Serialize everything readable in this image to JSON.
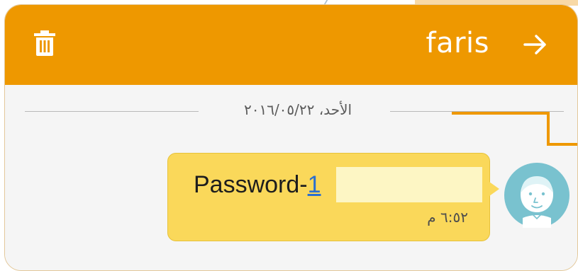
{
  "header": {
    "contact_name": "faris",
    "delete_icon": "trash-icon",
    "back_icon": "arrow-right-icon"
  },
  "conversation": {
    "date_separator": "الأحد، ٢٠١٦/٠٥/٢٢",
    "messages": [
      {
        "text_prefix": "Password-",
        "link_text": "1",
        "time": "٦:٥٢ م",
        "sender_avatar": "contact-avatar"
      }
    ]
  },
  "colors": {
    "app_bar": "#ee9800",
    "bubble": "#fad85a",
    "callout_line": "#ee9800",
    "link": "#2a6fcf"
  }
}
